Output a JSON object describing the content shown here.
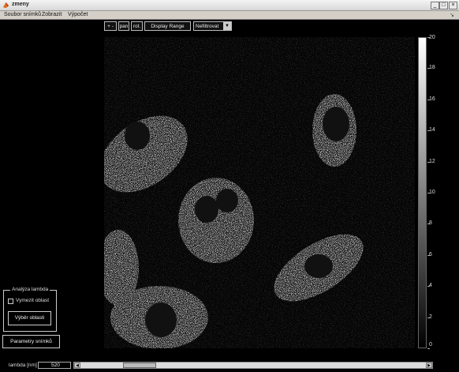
{
  "window": {
    "title": "zmeny"
  },
  "menu": [
    "Soubor snímků",
    "Zobrazit",
    "Výpočet"
  ],
  "toolbar": {
    "zoom_label": "+ -",
    "pan_label": "pan",
    "rot_label": "rot.",
    "display_range_label": "Display Range",
    "filter_value": "Nefiltrovat"
  },
  "colorbar": {
    "min": 0,
    "max": 20,
    "ticks": [
      "20",
      "18",
      "16",
      "14",
      "12",
      "10",
      "8",
      "6",
      "4",
      "2",
      "0"
    ]
  },
  "analysis": {
    "group_title": "Analýza lambda",
    "checkbox_label": "Vymezit oblast",
    "checkbox_checked": false,
    "select_region_button": "Výběr oblasti"
  },
  "params_button": "Parametry snímků",
  "lambda": {
    "label": "lambda [nm]",
    "value": "520"
  },
  "icons": {
    "app": "matlab-icon",
    "minimize": "minimize-icon",
    "maximize": "maximize-icon",
    "close": "close-icon",
    "pin": "pin-icon"
  }
}
